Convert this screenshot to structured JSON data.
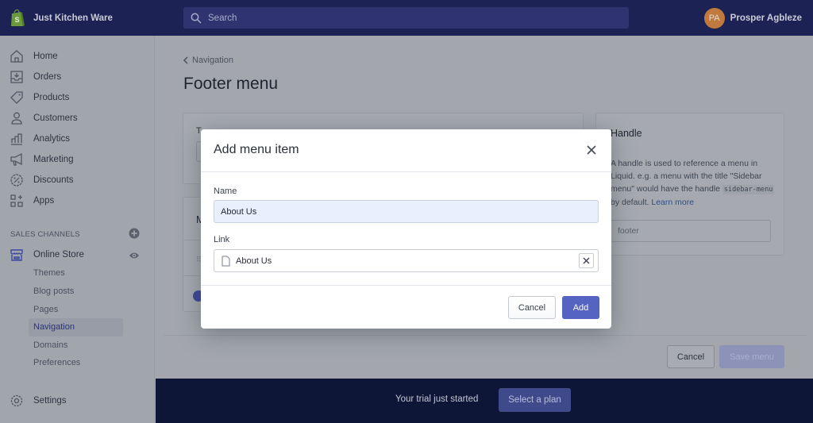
{
  "topbar": {
    "store_name": "Just Kitchen Ware",
    "search_placeholder": "Search",
    "user_initials": "PA",
    "user_name": "Prosper Agbleze"
  },
  "sidebar": {
    "items": [
      {
        "label": "Home",
        "icon": "home-icon"
      },
      {
        "label": "Orders",
        "icon": "orders-icon"
      },
      {
        "label": "Products",
        "icon": "tag-icon"
      },
      {
        "label": "Customers",
        "icon": "person-icon"
      },
      {
        "label": "Analytics",
        "icon": "bar-chart-icon"
      },
      {
        "label": "Marketing",
        "icon": "megaphone-icon"
      },
      {
        "label": "Discounts",
        "icon": "discount-icon"
      },
      {
        "label": "Apps",
        "icon": "apps-icon"
      }
    ],
    "sales_channels_title": "SALES CHANNELS",
    "online_store": "Online Store",
    "sub_items": [
      "Themes",
      "Blog posts",
      "Pages",
      "Navigation",
      "Domains",
      "Preferences"
    ],
    "active_sub_item": "Navigation",
    "settings": "Settings"
  },
  "main": {
    "breadcrumb": "Navigation",
    "page_title": "Footer menu",
    "title_card_label": "T",
    "menu_items_card_title": "M",
    "handle_card": {
      "title": "Handle",
      "desc_part1": "A handle is used to reference a menu in Liquid. e.g. a menu with the title \"Sidebar menu\" would have the handle ",
      "code": "sidebar-menu",
      "desc_part2": " by default. ",
      "learn_more": "Learn more",
      "value": "footer"
    },
    "cancel_label": "Cancel",
    "save_label": "Save menu"
  },
  "trial_bar": {
    "text": "Your trial just started",
    "button": "Select a plan"
  },
  "modal": {
    "title": "Add menu item",
    "name_label": "Name",
    "name_value": "About Us",
    "link_label": "Link",
    "link_value": "About Us",
    "cancel_label": "Cancel",
    "add_label": "Add"
  }
}
